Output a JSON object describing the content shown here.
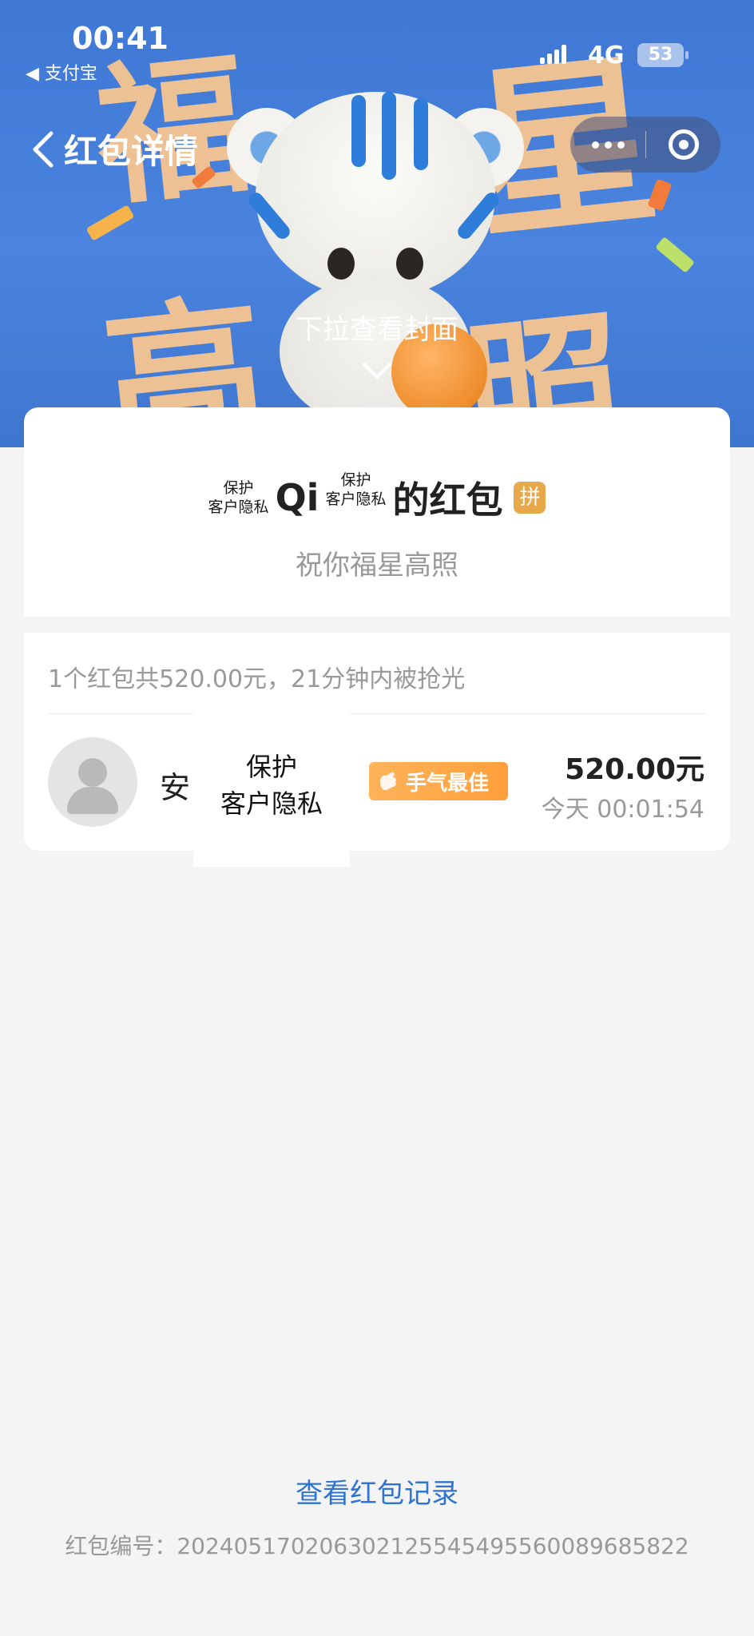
{
  "status_bar": {
    "time": "00:41",
    "back_app": "◀ 支付宝",
    "network": "4G",
    "battery": "53"
  },
  "navbar": {
    "title": "红包详情"
  },
  "banner": {
    "pull_hint": "下拉查看封面",
    "cover_chars": [
      "福",
      "星",
      "高",
      "照"
    ]
  },
  "card": {
    "sender_prefix_stamp_line1": "保护",
    "sender_prefix_stamp_line2": "客户隐私",
    "sender_name_part": "Qi",
    "sender_suffix": "的红包",
    "pin_badge": "拼",
    "blessing": "祝你福星高照"
  },
  "summary": "1个红包共520.00元，21分钟内被抢光",
  "receivers": [
    {
      "name_visible": "安",
      "privacy_line1": "保护",
      "privacy_line2": "客户隐私",
      "badge": "手气最佳",
      "amount": "520.00元",
      "time": "今天 00:01:54"
    }
  ],
  "footer": {
    "view_records": "查看红包记录",
    "serial": "红包编号：20240517020630212554549556008968582​2"
  },
  "colors": {
    "banner_blue": "#4a84df",
    "link_blue": "#2f74d0",
    "badge_orange": "#ffa84a"
  }
}
